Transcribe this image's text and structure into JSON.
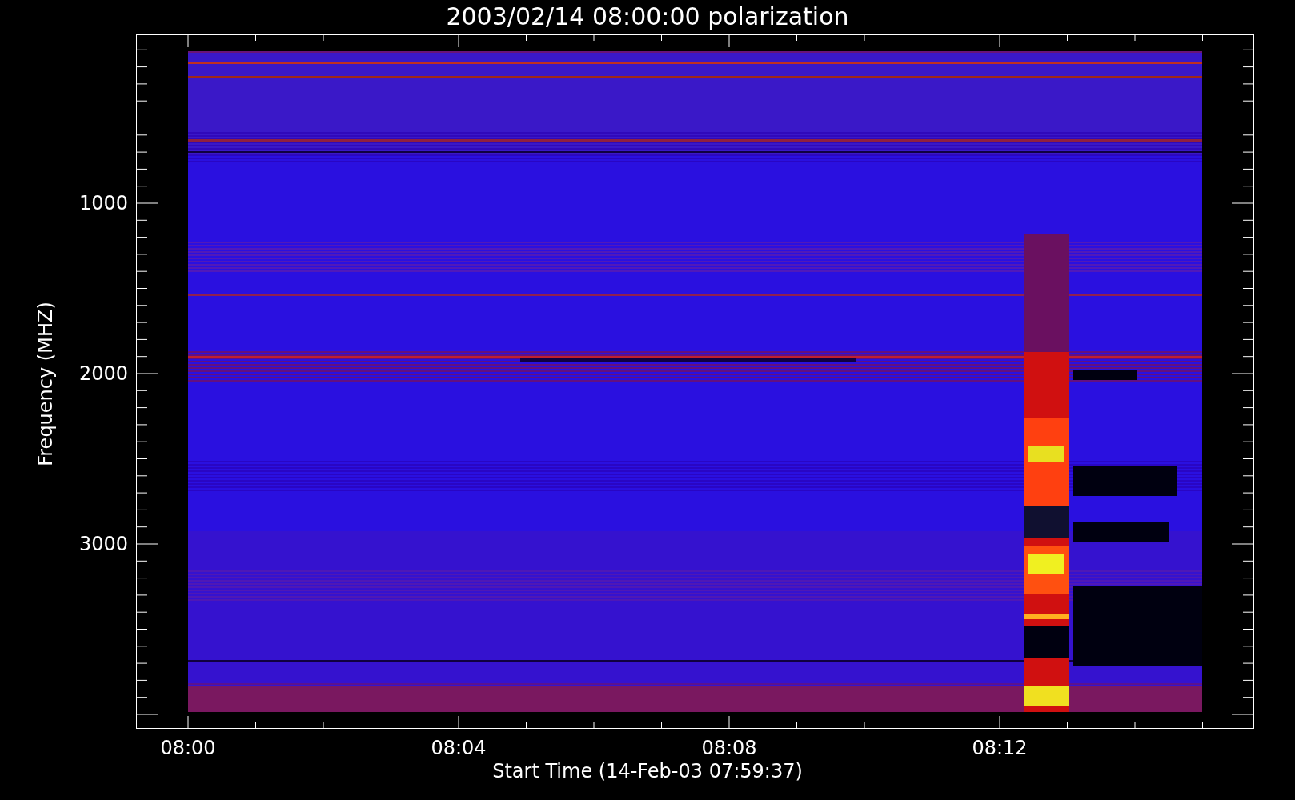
{
  "title": "2003/02/14 08:00:00 polarization",
  "y_axis": {
    "label": "Frequency (MHZ)",
    "ticks": [
      "1000",
      "2000",
      "3000"
    ]
  },
  "x_axis": {
    "label": "Start Time (14-Feb-03 07:59:37)",
    "ticks": [
      "08:00",
      "08:04",
      "08:08",
      "08:12"
    ]
  }
}
